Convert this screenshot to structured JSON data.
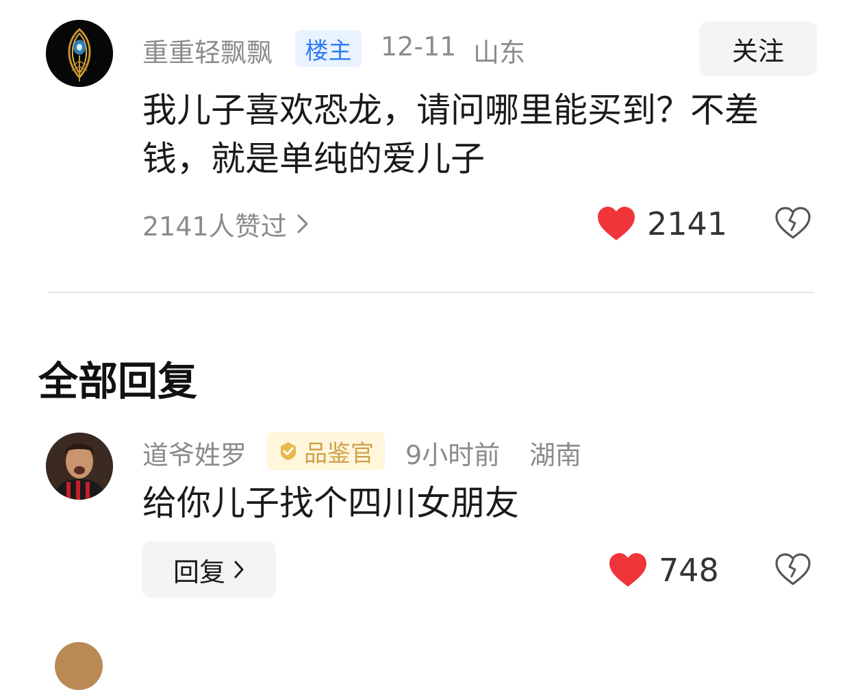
{
  "post": {
    "username": "重重轻飘飘",
    "badge": "楼主",
    "date": "12-11",
    "location": "山东",
    "follow_label": "关注",
    "content": "我儿子喜欢恐龙，请问哪里能买到？不差钱，就是单纯的爱儿子",
    "liked_by_text": "2141人赞过",
    "like_count": "2141"
  },
  "section_title": "全部回复",
  "reply": {
    "username": "道爷姓罗",
    "badge": "品鉴官",
    "time": "9小时前",
    "location": "湖南",
    "content": "给你儿子找个四川女朋友",
    "reply_label": "回复",
    "like_count": "748"
  },
  "colors": {
    "like_red": "#f0353a",
    "op_badge_bg": "#e9f2ff",
    "op_badge_text": "#2f7cf6",
    "expert_badge_bg": "#fff6dc",
    "expert_badge_text": "#d0a14a"
  }
}
